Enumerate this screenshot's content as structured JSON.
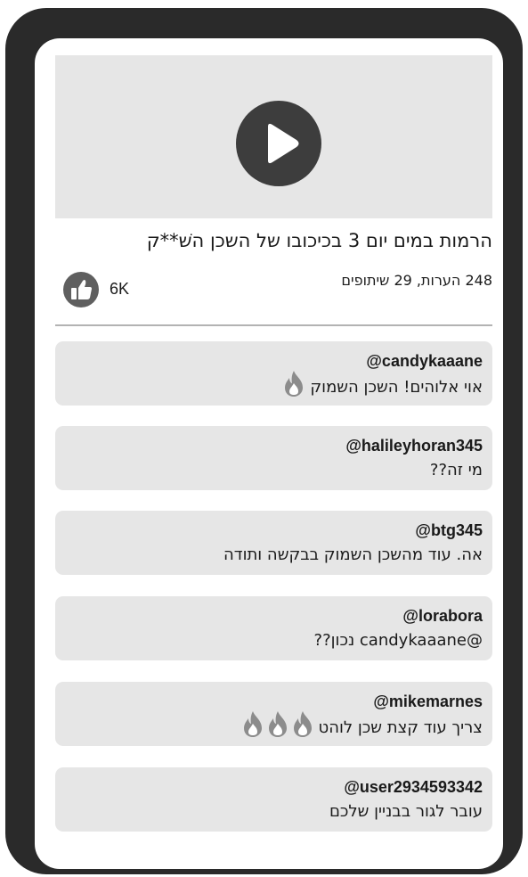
{
  "video": {
    "play_icon": "play-icon"
  },
  "post": {
    "title": "הרמות במים יום 3 בכיכובו של השכן השׁ**ק",
    "stats": "248 הערות, 29 שיתופים",
    "like_count": "6K",
    "like_icon": "thumbs-up-icon"
  },
  "colors": {
    "device": "#2a2a2a",
    "panel": "#e6e6e6",
    "button": "#3d3d3d",
    "like": "#5f5f5f"
  },
  "comments": [
    {
      "user": "@candykaaane",
      "text": "אוי אלוהים! השכן השמוק",
      "fires": 1
    },
    {
      "user": "@halileyhoran345",
      "text": "מי זה??",
      "fires": 0
    },
    {
      "user": "@btg345",
      "text": "אה. עוד מהשכן השמוק בבקשה ותודה",
      "fires": 0
    },
    {
      "user": "@lorabora",
      "text": "@candykaaane נכון??",
      "fires": 0
    },
    {
      "user": "@mikemarnes",
      "text": "צריך עוד קצת שכן לוהט",
      "fires": 3
    },
    {
      "user": "@user2934593342",
      "text": "עובר לגור בבניין שלכם",
      "fires": 0
    }
  ]
}
